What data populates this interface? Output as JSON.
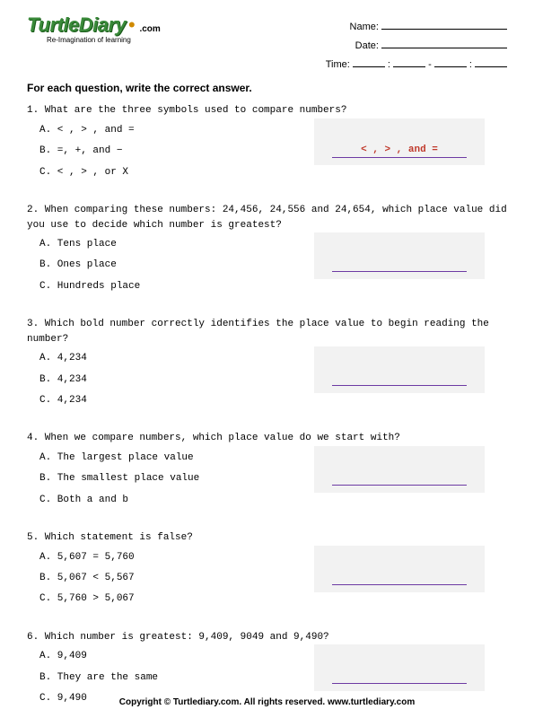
{
  "logo": {
    "brand": "TurtleDiary",
    "suffix": ".com",
    "tagline": "Re-Imagination of learning"
  },
  "header_fields": {
    "name": "Name:",
    "date": "Date:",
    "time": "Time:"
  },
  "instruction": "For each question, write the correct answer.",
  "questions": [
    {
      "num": "1.",
      "text": "What are the three symbols used to compare numbers?",
      "options": [
        "A. < ,  > , and =",
        "B. =, +, and −",
        "C. < ,  > , or  X"
      ],
      "answer": "< ,  > , and ="
    },
    {
      "num": "2.",
      "text": "When comparing these numbers:  24,456, 24,556 and 24,654, which place value did you use to decide which number is greatest?",
      "options": [
        "A. Tens place",
        "B. Ones place",
        "C. Hundreds place"
      ],
      "answer": ""
    },
    {
      "num": "3.",
      "text": "Which bold number correctly identifies the place value to begin reading the number?",
      "options": [
        "A. 4,234",
        "B. 4,234",
        "C. 4,234"
      ],
      "answer": ""
    },
    {
      "num": "4.",
      "text": "When we compare numbers, which place value do we start with?",
      "options": [
        "A. The largest place value",
        "B. The smallest place value",
        "C. Both a and b"
      ],
      "answer": ""
    },
    {
      "num": "5.",
      "text": "Which statement is false?",
      "options": [
        "A. 5,607 = 5,760",
        "B. 5,067 < 5,567",
        "C. 5,760 > 5,067"
      ],
      "answer": ""
    },
    {
      "num": "6.",
      "text": "Which number is greatest:  9,409, 9049 and 9,490?",
      "options": [
        "A. 9,409",
        "B. They are the same",
        "C. 9,490"
      ],
      "answer": ""
    }
  ],
  "footer": "Copyright © Turtlediary.com. All rights reserved. www.turtlediary.com"
}
